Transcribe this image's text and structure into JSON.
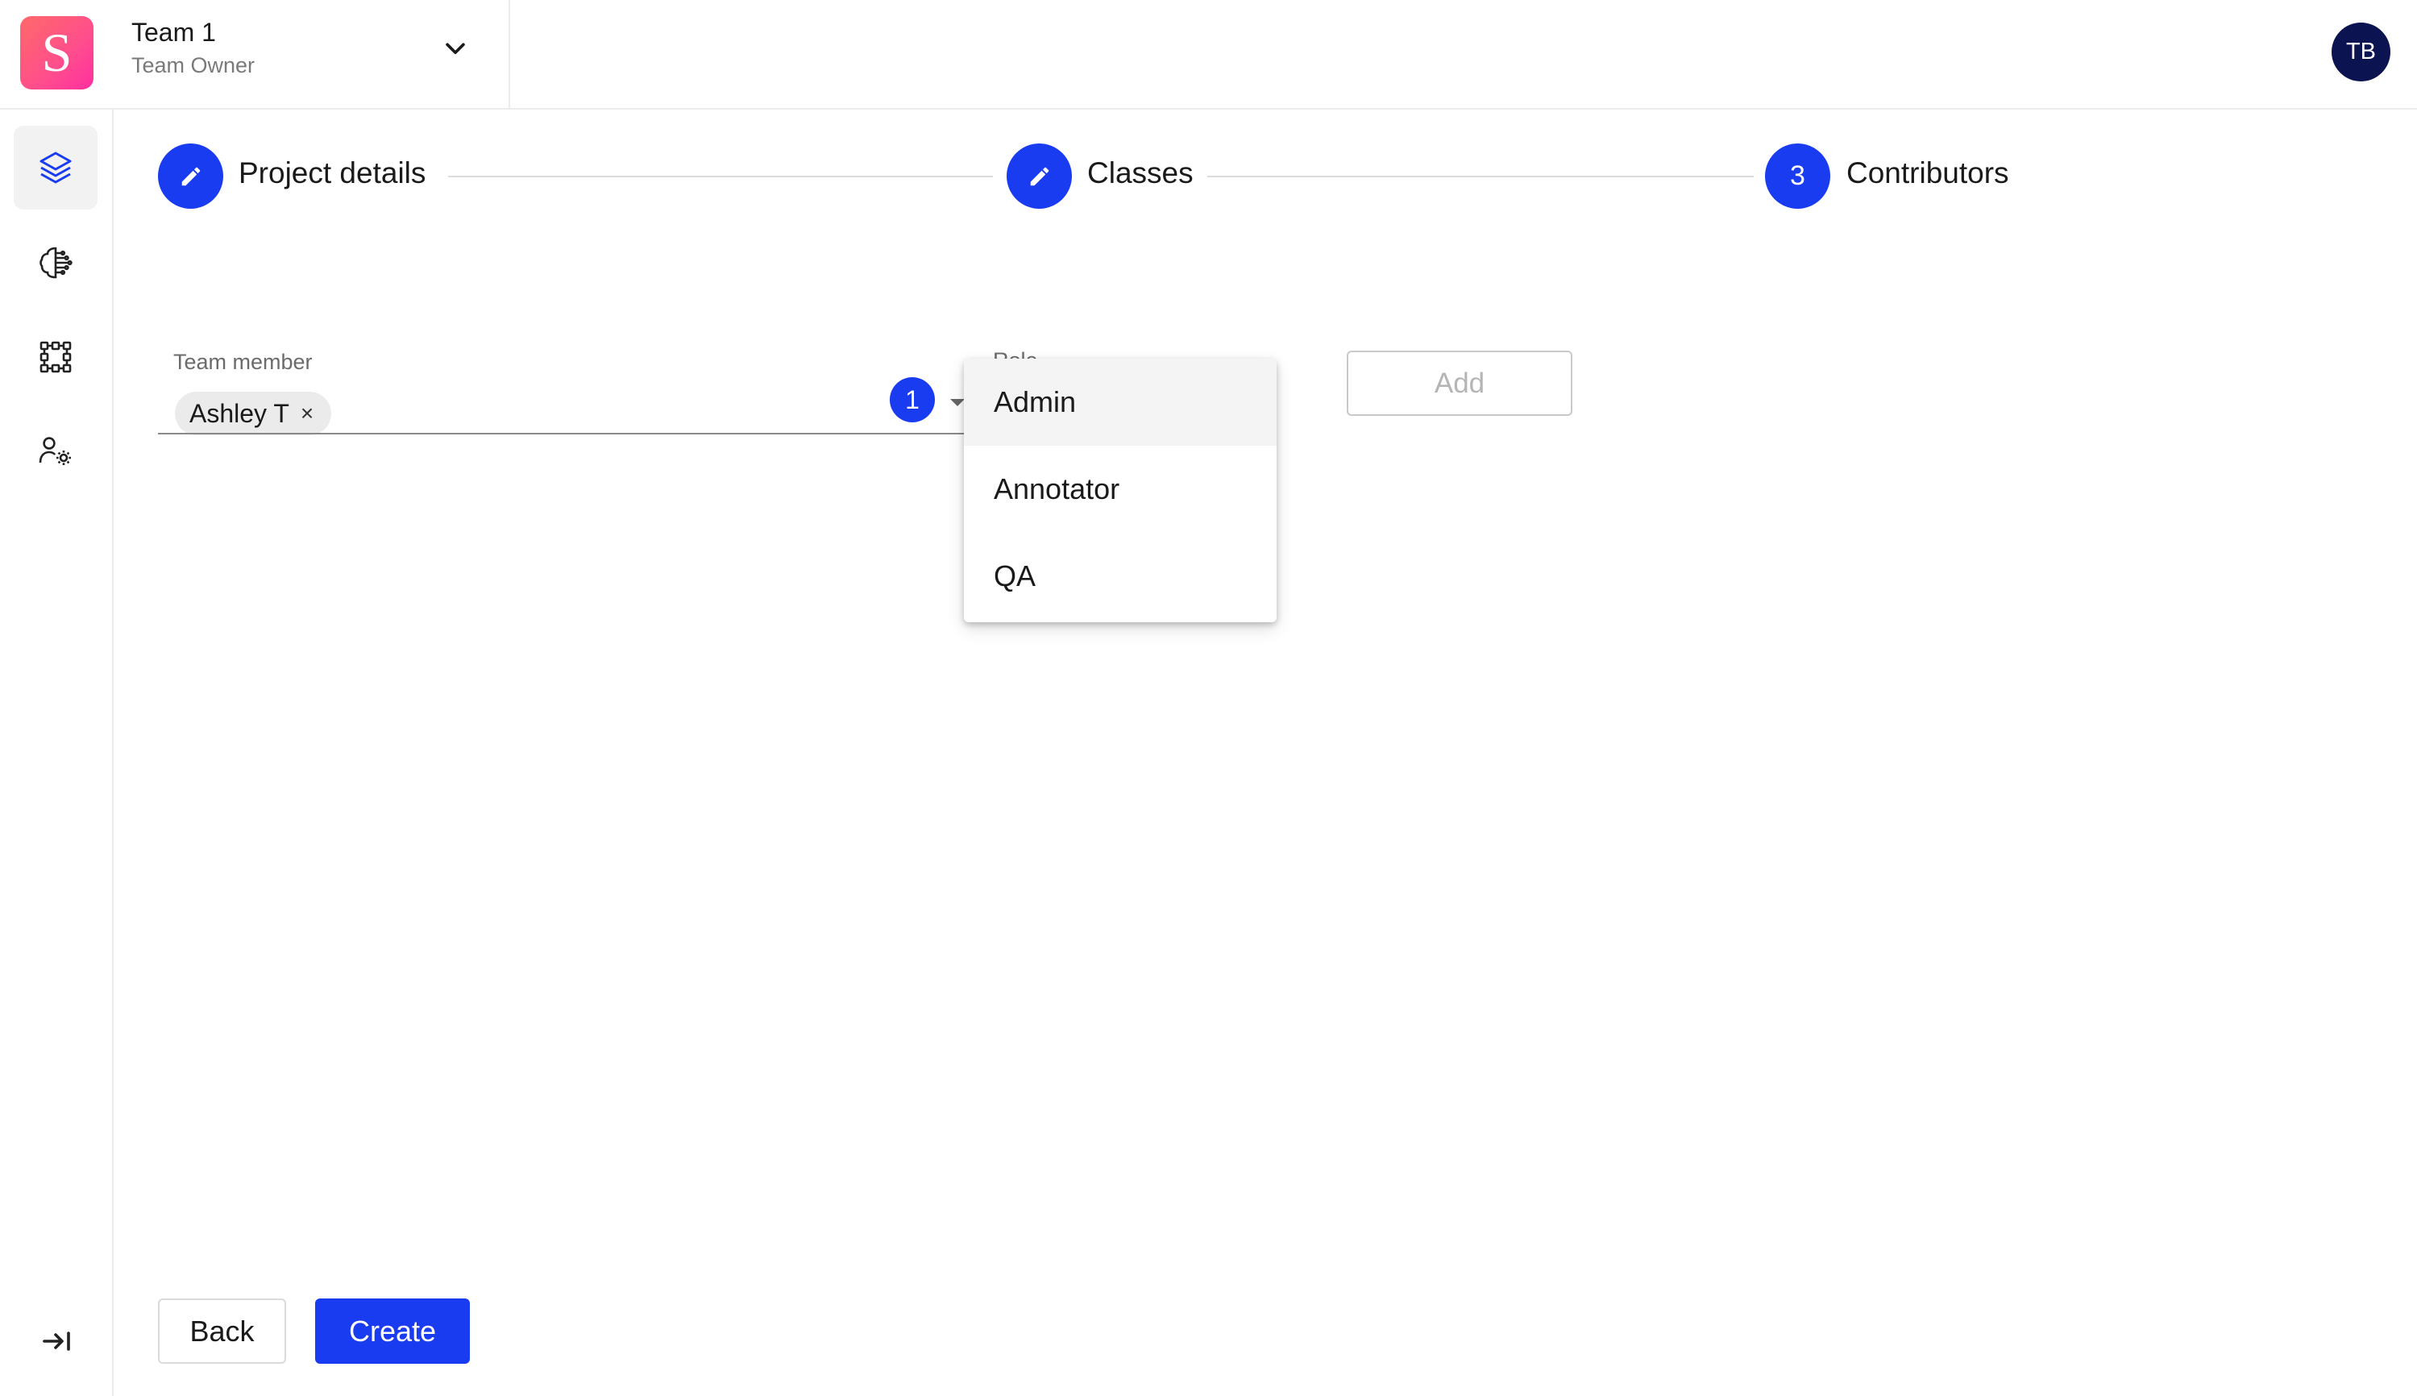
{
  "header": {
    "logo_letter": "S",
    "team_name": "Team 1",
    "team_role": "Team Owner",
    "user_initials": "TB"
  },
  "sidebar": {
    "items": [
      {
        "name": "projects",
        "icon": "layers-icon",
        "active": true
      },
      {
        "name": "models",
        "icon": "brain-icon",
        "active": false
      },
      {
        "name": "workflows",
        "icon": "grid-nodes-icon",
        "active": false
      },
      {
        "name": "team-settings",
        "icon": "users-gear-icon",
        "active": false
      }
    ],
    "collapse_icon": "collapse-right-icon"
  },
  "stepper": {
    "steps": [
      {
        "label": "Project details",
        "marker": "edit",
        "state": "completed"
      },
      {
        "label": "Classes",
        "marker": "edit",
        "state": "completed"
      },
      {
        "label": "Contributors",
        "marker": "3",
        "state": "active"
      }
    ]
  },
  "form": {
    "team_member_label": "Team member",
    "selected_members": [
      "Ashley T"
    ],
    "chip_remove": "×",
    "selected_count": "1",
    "role_label": "Role",
    "role_options": [
      "Admin",
      "Annotator",
      "QA"
    ],
    "highlighted_option": "Admin",
    "add_label": "Add"
  },
  "footer": {
    "back_label": "Back",
    "create_label": "Create"
  },
  "colors": {
    "accent": "#1a3cf0",
    "avatar_bg": "#0b1450",
    "logo_gradient_start": "#ff6a6a",
    "logo_gradient_end": "#ff2fa0"
  }
}
